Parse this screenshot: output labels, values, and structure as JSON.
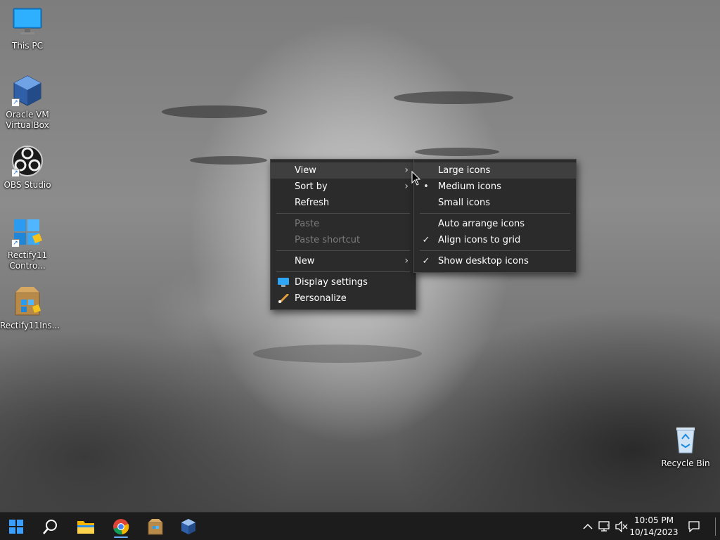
{
  "desktop": {
    "icons": [
      {
        "label": "This PC"
      },
      {
        "label": "Oracle VM VirtualBox"
      },
      {
        "label": "OBS Studio"
      },
      {
        "label": "Rectify11 Contro..."
      },
      {
        "label": "Rectify11Ins..."
      },
      {
        "label": "Recycle Bin"
      }
    ]
  },
  "context_menu": {
    "items": [
      {
        "label": "View",
        "submenu": true,
        "highlighted": true
      },
      {
        "label": "Sort by",
        "submenu": true
      },
      {
        "label": "Refresh"
      },
      {
        "label": "Paste",
        "disabled": true
      },
      {
        "label": "Paste shortcut",
        "disabled": true
      },
      {
        "label": "New",
        "submenu": true
      },
      {
        "label": "Display settings",
        "icon": "display-icon"
      },
      {
        "label": "Personalize",
        "icon": "brush-icon"
      }
    ]
  },
  "view_submenu": {
    "items": [
      {
        "label": "Large icons",
        "highlighted": true
      },
      {
        "label": "Medium icons",
        "mark": "bullet"
      },
      {
        "label": "Small icons"
      },
      {
        "label": "Auto arrange icons"
      },
      {
        "label": "Align icons to grid",
        "mark": "check"
      },
      {
        "label": "Show desktop icons",
        "mark": "check"
      }
    ]
  },
  "taskbar": {
    "apps": [
      "start-icon",
      "search-icon",
      "file-explorer-icon",
      "chrome-icon",
      "installer-icon",
      "virtualbox-icon"
    ],
    "clock": {
      "time": "10:05 PM",
      "date": "10/14/2023"
    }
  },
  "colors": {
    "menu_bg": "#2b2b2b",
    "menu_hover": "#3f3f3f",
    "taskbar_bg": "#1c1c1c",
    "accent": "#0078d4"
  }
}
